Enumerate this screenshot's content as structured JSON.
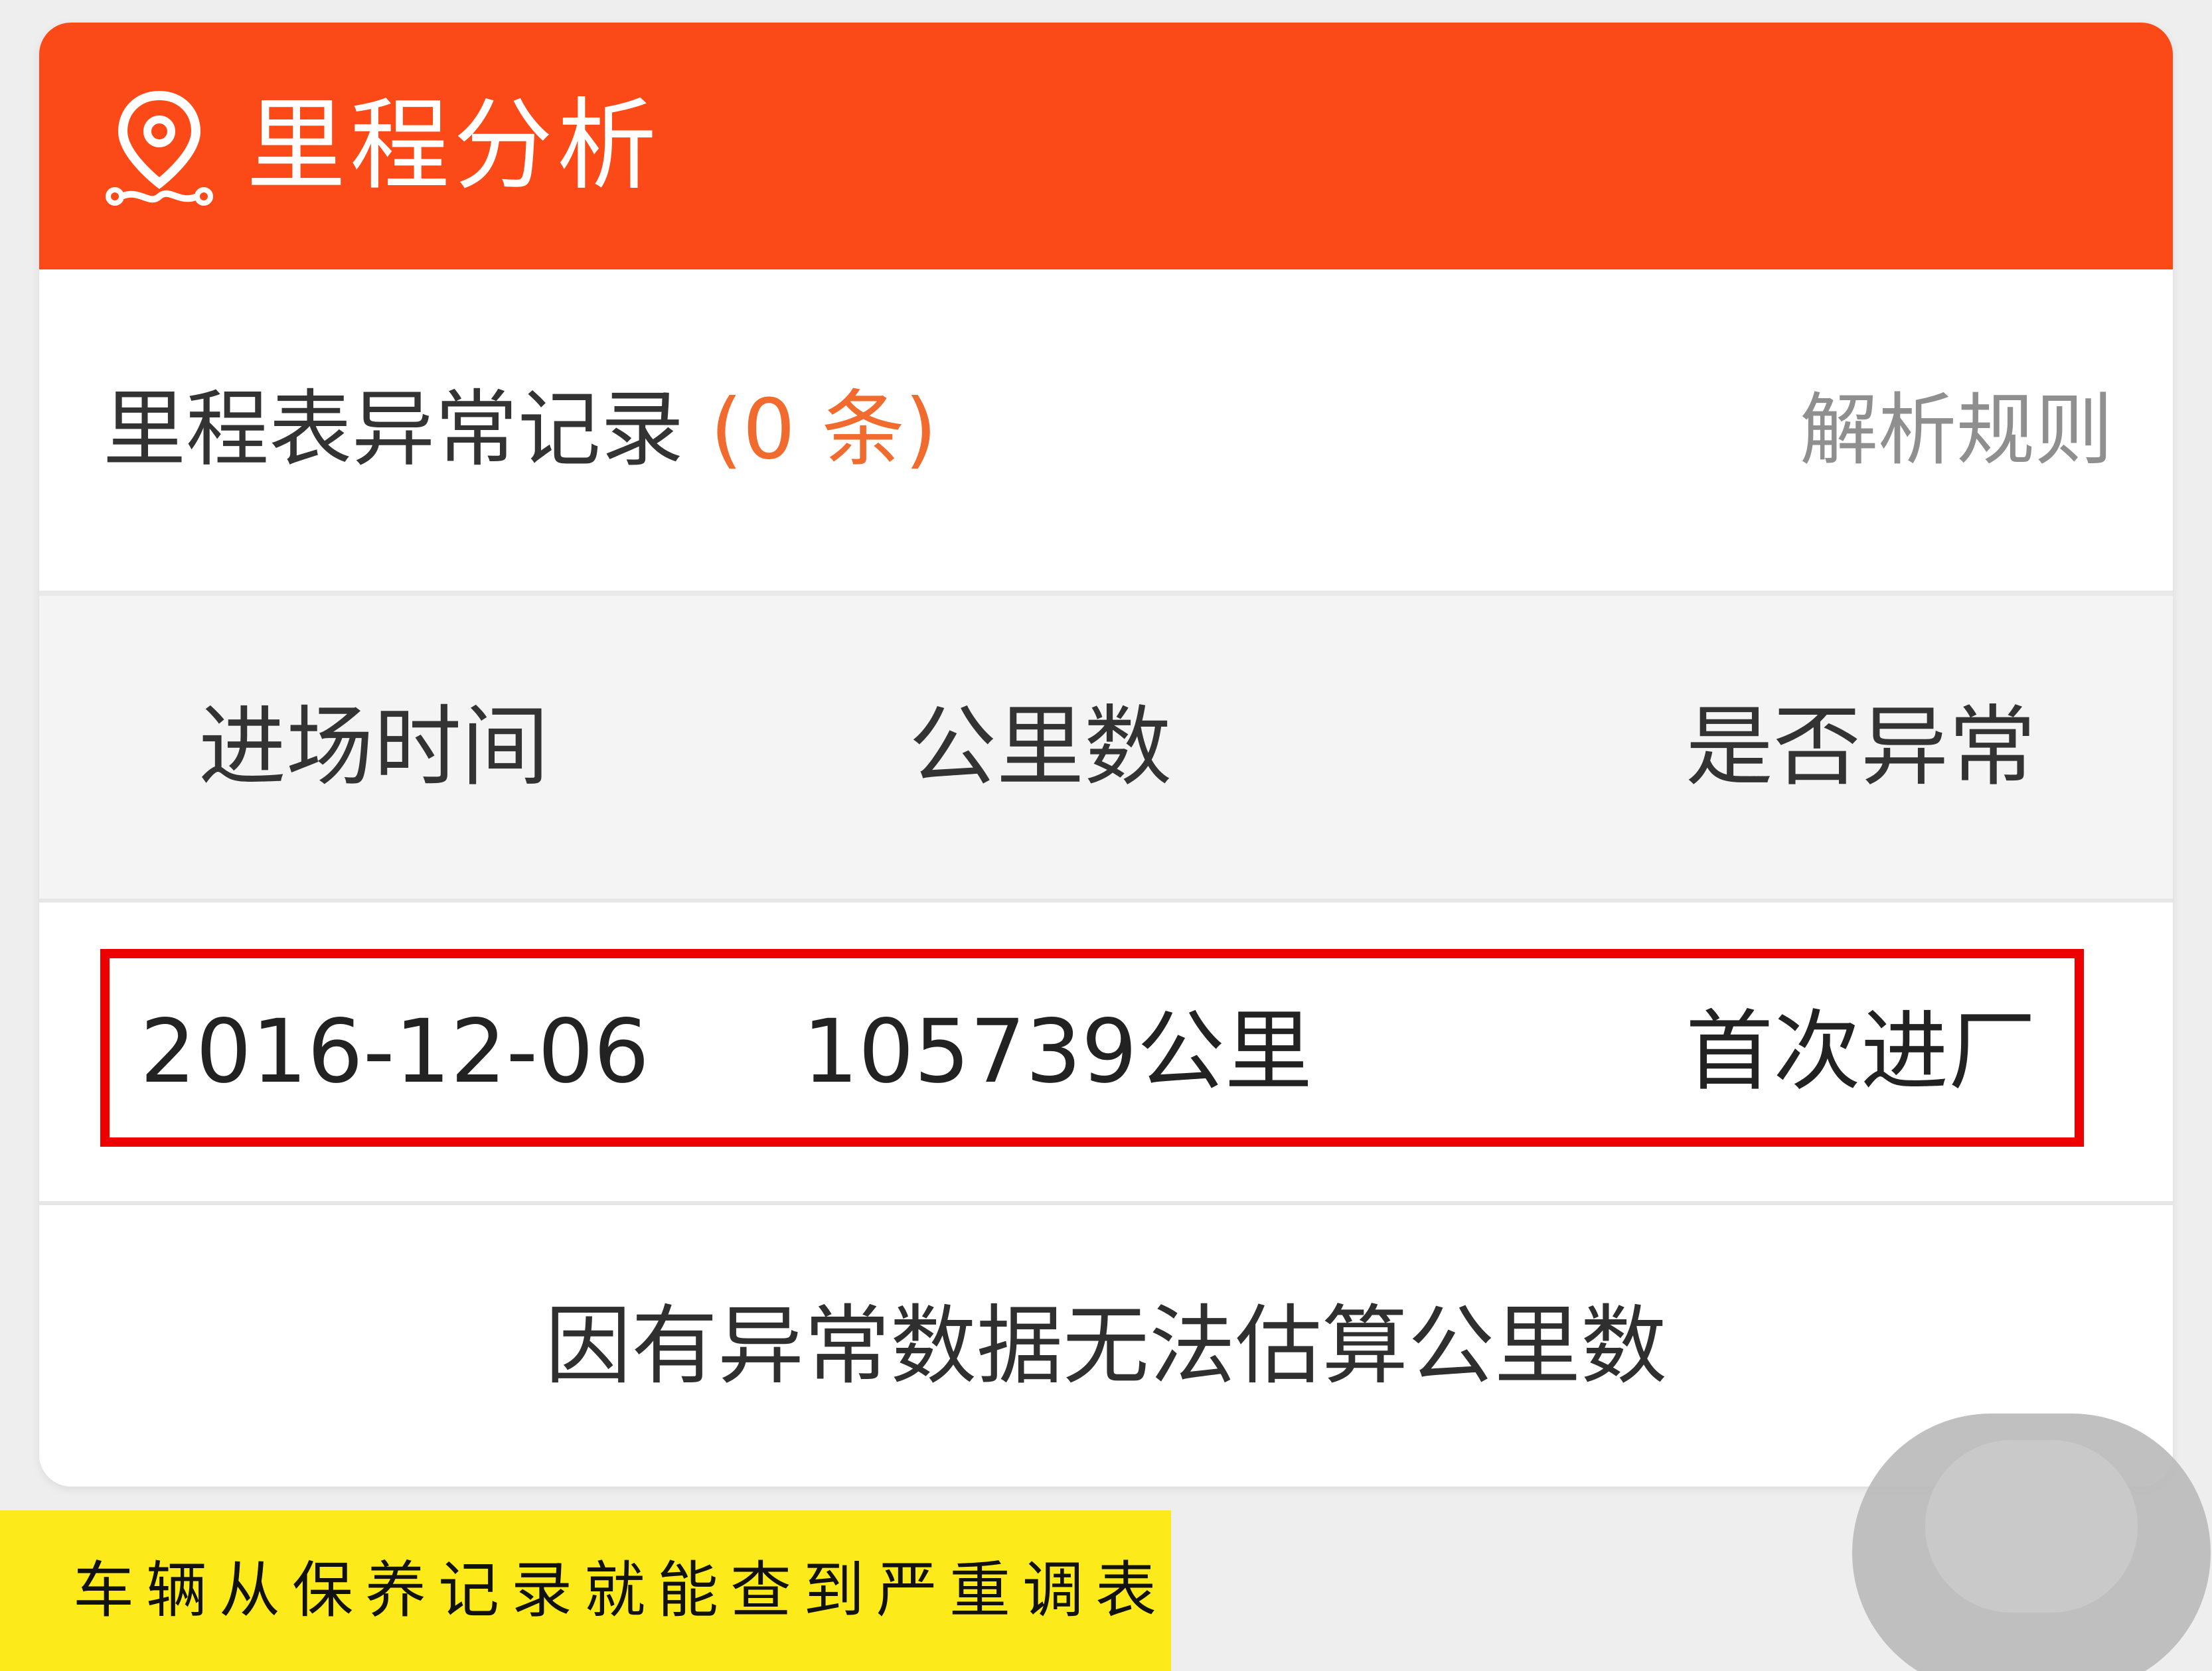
{
  "header": {
    "icon": "location-pin-route-icon",
    "title": "里程分析"
  },
  "summary": {
    "title": "里程表异常记录",
    "count_label": "(0 条)",
    "rules_link": "解析规则"
  },
  "table": {
    "columns": [
      "进场时间",
      "公里数",
      "是否异常"
    ],
    "rows": [
      {
        "date": "2016-12-06",
        "mileage": "105739公里",
        "status": "首次进厂"
      }
    ]
  },
  "note": "因有异常数据无法估算公里数",
  "caption": "车辆从保养记录就能查到严重调表",
  "colors": {
    "header": "#fb4a17",
    "accent_count": "#f16a2e",
    "highlight_border": "#ee0000",
    "caption_bg": "#fdea1a"
  }
}
